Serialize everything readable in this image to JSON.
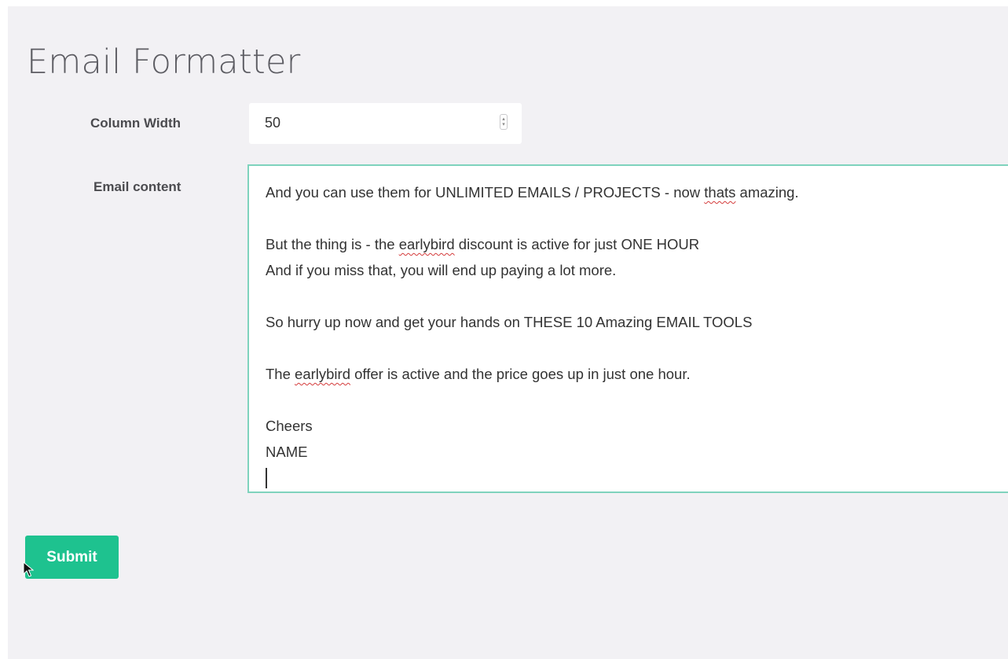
{
  "page": {
    "title": "Email Formatter"
  },
  "form": {
    "column_width_label": "Column Width",
    "column_width_value": "50",
    "email_content_label": "Email content",
    "email_lines": {
      "l1_pre": "And you can use them for UNLIMITED EMAILS / PROJECTS - now ",
      "l1_spell": "thats",
      "l1_post": " amazing.",
      "l2_pre": "But the thing is - the ",
      "l2_spell": "earlybird",
      "l2_post": " discount is active for just ONE HOUR",
      "l3": "And if you miss that, you will end up paying a lot more.",
      "l4": "So hurry up now and get your hands on THESE 10 Amazing EMAIL TOOLS",
      "l5_pre": "The ",
      "l5_spell": "earlybird",
      "l5_post": " offer is active and the price goes up in just one hour.",
      "l6": "Cheers",
      "l7": "NAME"
    },
    "submit_label": "Submit"
  },
  "colors": {
    "accent": "#1ec28f",
    "focus_border": "#7fd3bd",
    "background": "#f2f1f4"
  },
  "icons": {
    "spinner": "number-spinner-icon",
    "cursor": "mouse-pointer-icon"
  }
}
